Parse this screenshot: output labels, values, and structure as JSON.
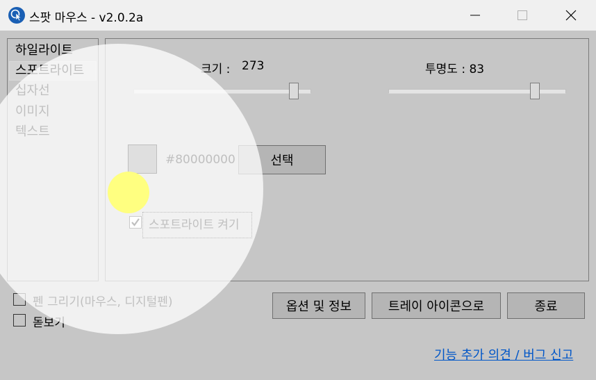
{
  "window": {
    "title": "스팟 마우스 - v2.0.2a",
    "icon": "cursor-pointer-icon",
    "buttons": [
      "minimize-icon",
      "maximize-icon",
      "close-icon"
    ]
  },
  "sidebar": {
    "items": [
      {
        "label": "하일라이트",
        "selected": false
      },
      {
        "label": "스포트라이트",
        "selected": true
      },
      {
        "label": "십자선",
        "selected": false
      },
      {
        "label": "이미지",
        "selected": false
      },
      {
        "label": "텍스트",
        "selected": false
      }
    ]
  },
  "spotlight": {
    "size_label": "크기 :",
    "size_value": "273",
    "size_fraction": 0.91,
    "opacity_label": "투명도 : 83",
    "opacity_fraction": 0.83,
    "color_value": "#80000000",
    "select_button": "선택",
    "enable_label": "스포트라이트 켜기",
    "enable_checked": true
  },
  "bottom": {
    "pen_draw_label": "펜 그리기(마우스, 디지털펜)",
    "pen_draw_checked": false,
    "magnifier_label": "돋보기",
    "magnifier_checked": false,
    "options_button": "옵션 및 정보",
    "tray_button": "트레이 아이콘으로",
    "exit_button": "종료",
    "feedback_link": "기능 추가 의견 / 버그 신고"
  },
  "colors": {
    "background": "#c6c6c6",
    "titlebar": "#f0f0f0",
    "swatch": "#808080",
    "link": "#0056c8",
    "spotlight_overlay": "#ffffff",
    "cursor_highlight": "#ffff80"
  }
}
